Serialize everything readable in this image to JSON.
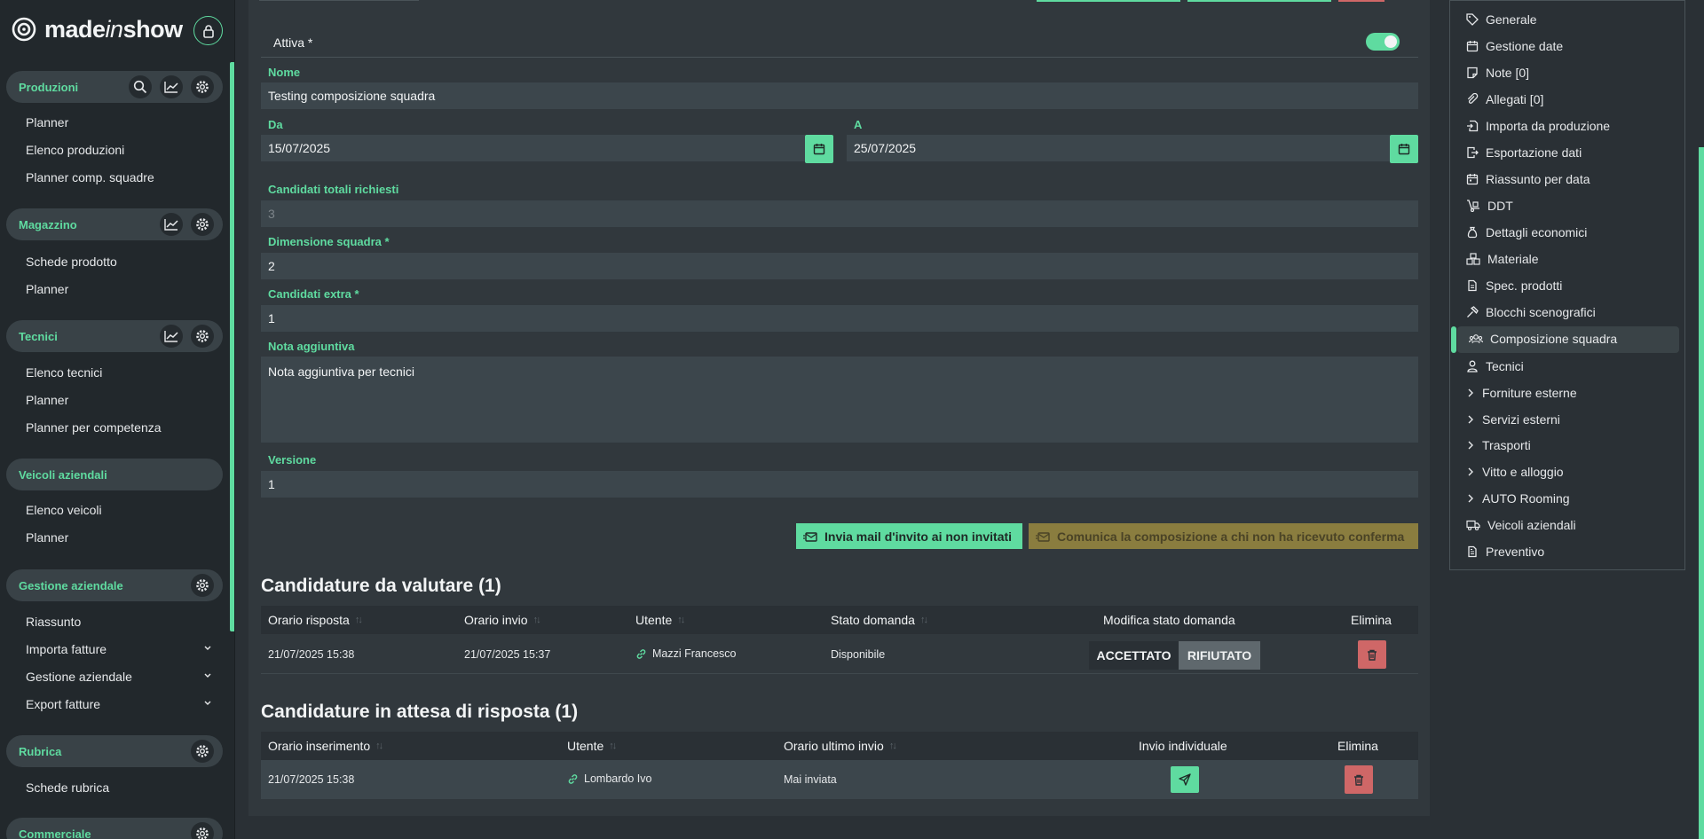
{
  "app": {
    "logo_main": "made",
    "logo_italic": "in",
    "logo_tail": "show"
  },
  "sidebar": {
    "sections": [
      {
        "title": "Produzioni",
        "items": [
          "Planner",
          "Elenco produzioni",
          "Planner comp. squadre"
        ]
      },
      {
        "title": "Magazzino",
        "items": [
          "Schede prodotto",
          "Planner"
        ]
      },
      {
        "title": "Tecnici",
        "items": [
          "Elenco tecnici",
          "Planner",
          "Planner per competenza"
        ]
      },
      {
        "title": "Veicoli aziendali",
        "items": [
          "Elenco veicoli",
          "Planner"
        ]
      },
      {
        "title": "Gestione aziendale",
        "items": [
          "Riassunto",
          "Importa fatture",
          "Gestione aziendale",
          "Export fatture"
        ]
      },
      {
        "title": "Rubrica",
        "items": [
          "Schede rubrica"
        ]
      },
      {
        "title": "Commerciale",
        "items": []
      }
    ]
  },
  "form": {
    "active_label": "Attiva *",
    "active_value": true,
    "name_label": "Nome",
    "name_value": "Testing composizione squadra",
    "from_label": "Da",
    "from_value": "15/07/2025",
    "to_label": "A",
    "to_value": "25/07/2025",
    "total_label": "Candidati totali richiesti",
    "total_value": "3",
    "size_label": "Dimensione squadra *",
    "size_value": "2",
    "extra_label": "Candidati extra *",
    "extra_value": "1",
    "note_label": "Nota aggiuntiva",
    "note_value": "Nota aggiuntiva per tecnici",
    "version_label": "Versione",
    "version_value": "1",
    "btn_invite": "Invia mail d'invito ai non invitati",
    "btn_communicate": "Comunica la composizione a chi non ha ricevuto conferma"
  },
  "table_eval": {
    "title": "Candidature da valutare (1)",
    "headers": [
      "Orario risposta",
      "Orario invio",
      "Utente",
      "Stato domanda",
      "Modifica stato domanda",
      "Elimina"
    ],
    "rows": [
      {
        "reply_time": "21/07/2025 15:38",
        "sent_time": "21/07/2025 15:37",
        "user": "Mazzi Francesco",
        "status": "Disponibile",
        "accept": "ACCETTATO",
        "reject": "RIFIUTATO"
      }
    ]
  },
  "table_wait": {
    "title": "Candidature in attesa di risposta (1)",
    "headers": [
      "Orario inserimento",
      "Utente",
      "Orario ultimo invio",
      "Invio individuale",
      "Elimina"
    ],
    "rows": [
      {
        "insert_time": "21/07/2025 15:38",
        "user": "Lombardo Ivo",
        "last_sent": "Mai inviata"
      }
    ]
  },
  "rpanel": {
    "items": [
      "Generale",
      "Gestione date",
      "Note [0]",
      "Allegati [0]",
      "Importa da produzione",
      "Esportazione dati",
      "Riassunto per data",
      "DDT",
      "Dettagli economici",
      "Materiale",
      "Spec. prodotti",
      "Blocchi scenografici",
      "Composizione squadra",
      "Tecnici",
      "Forniture esterne",
      "Servizi esterni",
      "Trasporti",
      "Vitto e alloggio",
      "AUTO Rooming",
      "Veicoli aziendali",
      "Preventivo"
    ],
    "active": "Composizione squadra"
  },
  "colors": {
    "accent": "#5fdba0",
    "danger": "#cf6767",
    "warning": "#8a7d3f",
    "bg": "#2a3035"
  }
}
